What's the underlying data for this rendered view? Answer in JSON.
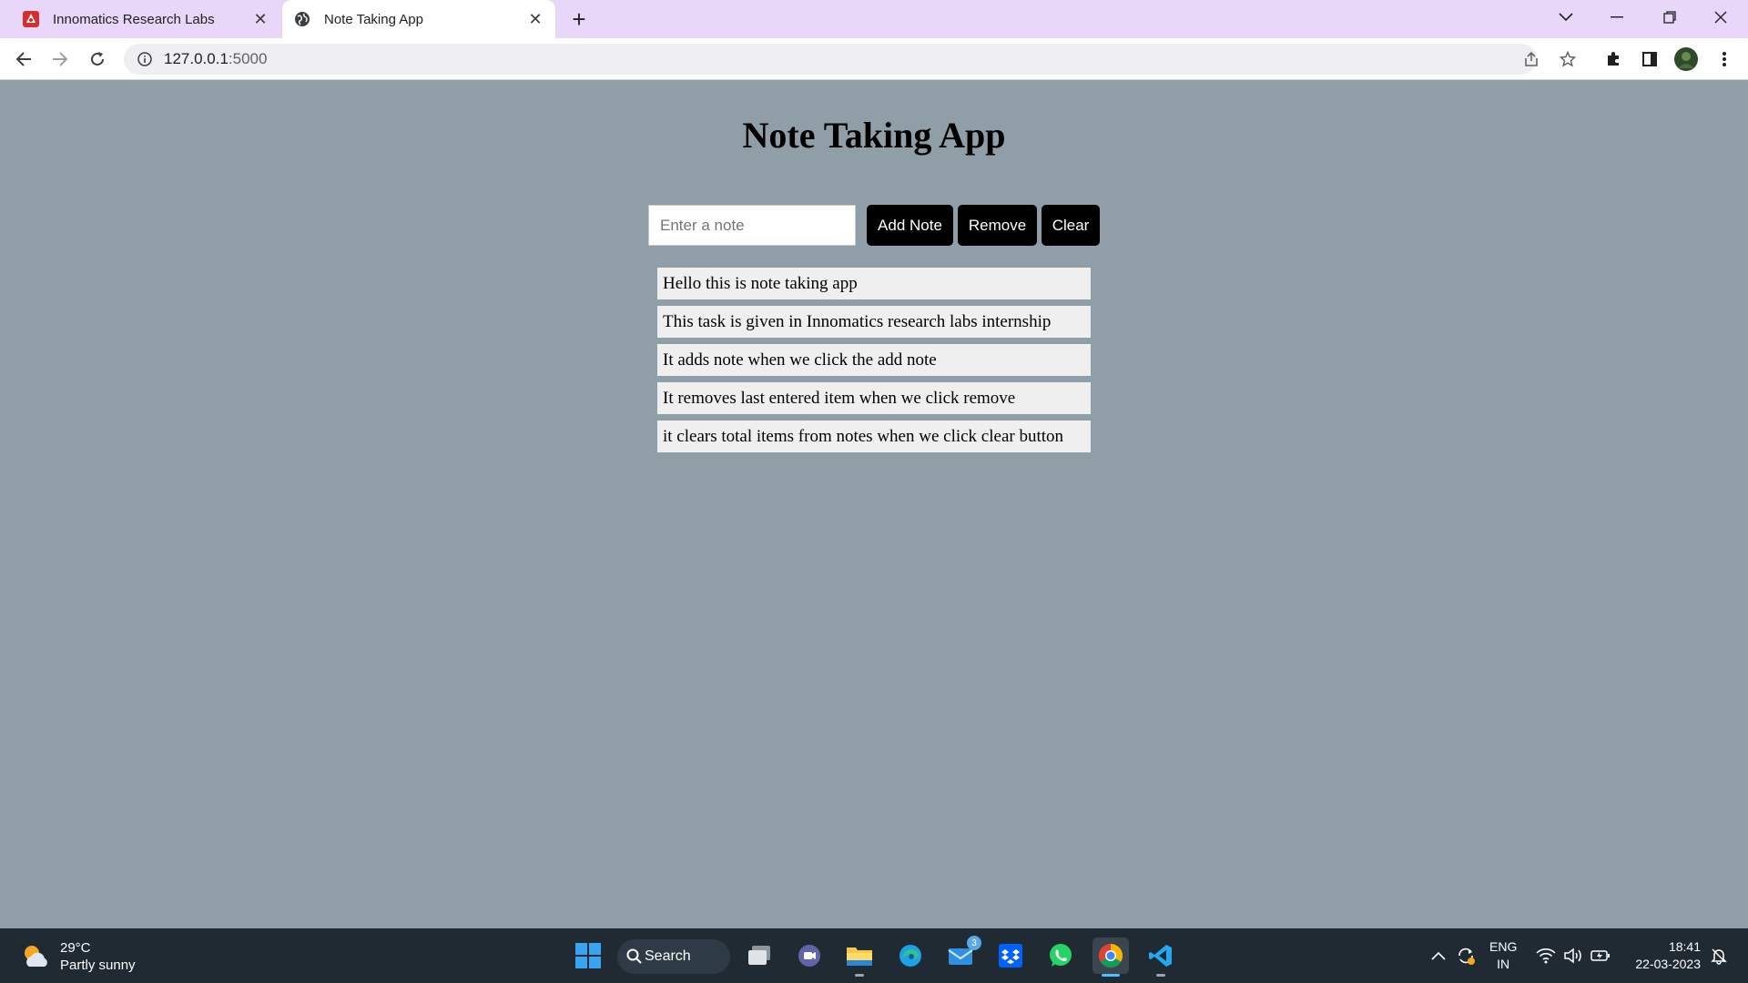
{
  "browser": {
    "tabs": [
      {
        "title": "Innomatics Research Labs",
        "active": false
      },
      {
        "title": "Note Taking App",
        "active": true
      }
    ],
    "url_host": "127.0.0.1",
    "url_port": ":5000"
  },
  "app": {
    "title": "Note Taking App",
    "input_placeholder": "Enter a note",
    "buttons": {
      "add": "Add Note",
      "remove": "Remove",
      "clear": "Clear"
    },
    "notes": [
      "Hello this is note taking app",
      "This task is given in Innomatics research labs internship",
      "It adds note when we click the add note",
      "It removes last entered item when we click remove",
      "it clears total items from notes when we click clear button"
    ]
  },
  "taskbar": {
    "weather_temp": "29°C",
    "weather_desc": "Partly sunny",
    "search_label": "Search",
    "mail_badge": "3",
    "lang_line1": "ENG",
    "lang_line2": "IN",
    "time": "18:41",
    "date": "22-03-2023"
  },
  "colors": {
    "page_background": "#909ea8",
    "tabstrip": "#e8d7f9",
    "button_bg": "#000000",
    "note_bg": "#efefef",
    "taskbar": "#1f2a33"
  }
}
